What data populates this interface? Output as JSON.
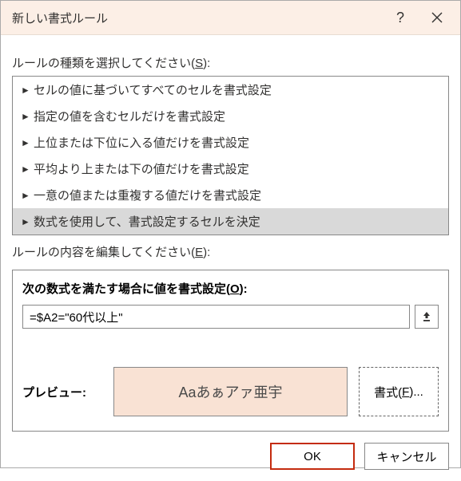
{
  "titlebar": {
    "title": "新しい書式ルール"
  },
  "section": {
    "rule_type_label_pre": "ルールの種類を選択してください(",
    "rule_type_key": "S",
    "rule_type_label_post": "):",
    "edit_label_pre": "ルールの内容を編集してください(",
    "edit_key": "E",
    "edit_label_post": "):"
  },
  "rule_types": [
    "セルの値に基づいてすべてのセルを書式設定",
    "指定の値を含むセルだけを書式設定",
    "上位または下位に入る値だけを書式設定",
    "平均より上または下の値だけを書式設定",
    "一意の値または重複する値だけを書式設定",
    "数式を使用して、書式設定するセルを決定"
  ],
  "selected_rule_index": 5,
  "edit": {
    "header_pre": "次の数式を満たす場合に値を書式設定(",
    "header_key": "O",
    "header_post": "):",
    "formula": "=$A2=\"60代以上\""
  },
  "preview": {
    "label": "プレビュー:",
    "sample": "Aaあぁアァ亜宇",
    "format_btn_pre": "書式(",
    "format_btn_key": "F",
    "format_btn_post": ")..."
  },
  "footer": {
    "ok": "OK",
    "cancel": "キャンセル"
  }
}
